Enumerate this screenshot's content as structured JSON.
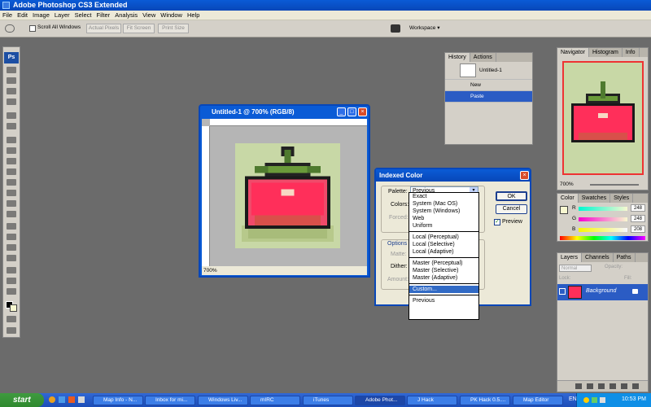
{
  "app": {
    "title": "Adobe Photoshop CS3 Extended"
  },
  "menu": [
    "File",
    "Edit",
    "Image",
    "Layer",
    "Select",
    "Filter",
    "Analysis",
    "View",
    "Window",
    "Help"
  ],
  "options": {
    "scroll_all": "Scroll All Windows",
    "actual_pixels": "Actual Pixels",
    "fit_screen": "Fit Screen",
    "print_size": "Print Size",
    "workspace": "Workspace ▾"
  },
  "toolbox": {
    "logo": "Ps"
  },
  "document": {
    "title": "Untitled-1 @ 700% (RGB/8)",
    "zoom": "700%"
  },
  "history": {
    "tabs": [
      "History",
      "Actions"
    ],
    "snapshot": "Untitled-1",
    "steps": [
      "New",
      "Paste"
    ],
    "selected": "Paste"
  },
  "navigator": {
    "tabs": [
      "Navigator",
      "Histogram",
      "Info"
    ],
    "zoom": "700%"
  },
  "color": {
    "tabs": [
      "Color",
      "Swatches",
      "Styles"
    ],
    "channels": [
      {
        "label": "R",
        "value": "248"
      },
      {
        "label": "G",
        "value": "248"
      },
      {
        "label": "B",
        "value": "208"
      }
    ]
  },
  "layers": {
    "tabs": [
      "Layers",
      "Channels",
      "Paths"
    ],
    "blend": "Normal",
    "opacity_label": "Opacity:",
    "fill_label": "Fill:",
    "lock_label": "Lock:",
    "layer_name": "Background"
  },
  "dialog": {
    "title": "Indexed Color",
    "palette_label": "Palette:",
    "palette_value": "Previous",
    "colors_label": "Colors:",
    "forced_label": "Forced:",
    "options_label": "Options",
    "matte_label": "Matte:",
    "dither_label": "Dither:",
    "amount_label": "Amount:",
    "ok": "OK",
    "cancel": "Cancel",
    "preview": "Preview",
    "preview_checked": true,
    "list_groups": [
      [
        "Exact",
        "System (Mac OS)",
        "System (Windows)",
        "Web",
        "Uniform"
      ],
      [
        "Local (Perceptual)",
        "Local (Selective)",
        "Local (Adaptive)"
      ],
      [
        "Master (Perceptual)",
        "Master (Selective)",
        "Master (Adaptive)"
      ],
      [
        "Custom..."
      ],
      [
        "Previous"
      ]
    ],
    "highlighted": "Custom..."
  },
  "taskbar": {
    "start": "start",
    "tasks": [
      "Map Info - N...",
      "Inbox for mi...",
      "Windows Liv...",
      "mIRC",
      "iTunes",
      "Adobe Phot...",
      "J Hack",
      "PK Hack 0.5....",
      "Map Editor"
    ],
    "active": "Adobe Phot...",
    "lang": "EN",
    "clock": "10:53 PM"
  }
}
